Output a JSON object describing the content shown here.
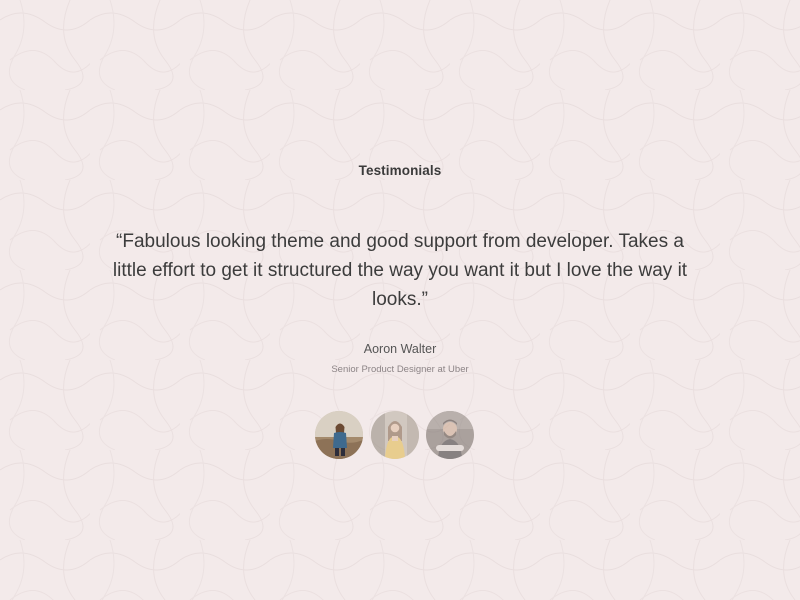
{
  "section": {
    "eyebrow": "Testimonials"
  },
  "testimonial": {
    "quote": "“Fabulous looking theme and good support from developer. Takes a little effort to get it structured the way you want it but I love the way it looks.”",
    "author_name": "Aoron Walter",
    "author_role": "Senior Product Designer at Uber"
  },
  "avatars": [
    {
      "name": "avatar-1",
      "active": true
    },
    {
      "name": "avatar-2",
      "active": false
    },
    {
      "name": "avatar-3",
      "active": false
    }
  ],
  "colors": {
    "background": "#f3eaea",
    "text": "#3c3c3c",
    "muted": "#8c8486"
  }
}
